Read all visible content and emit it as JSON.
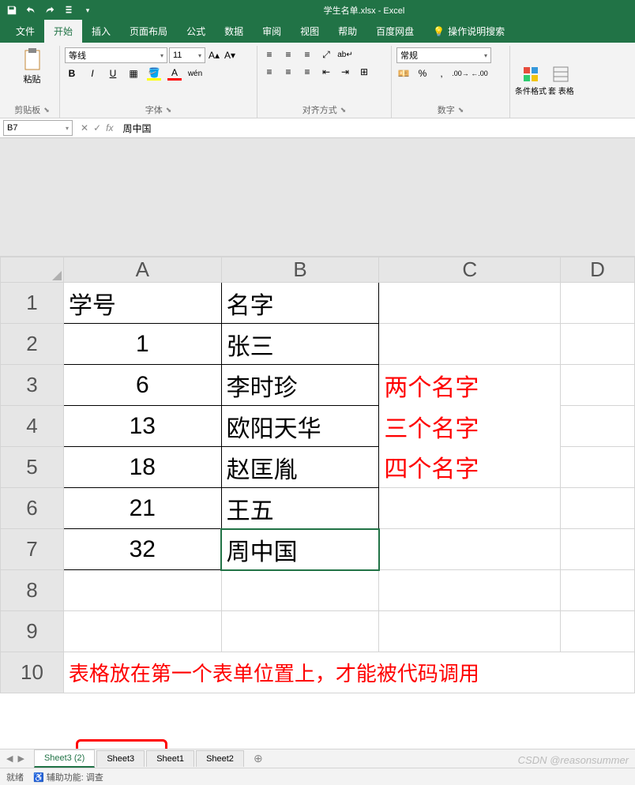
{
  "title": "学生名单.xlsx - Excel",
  "tabs": {
    "file": "文件",
    "home": "开始",
    "insert": "插入",
    "layout": "页面布局",
    "formulas": "公式",
    "data": "数据",
    "review": "审阅",
    "view": "视图",
    "help": "帮助",
    "baidu": "百度网盘",
    "tellme": "操作说明搜索"
  },
  "ribbon": {
    "clipboard": {
      "paste": "粘贴",
      "label": "剪贴板"
    },
    "font": {
      "name": "等线",
      "size": "11",
      "label": "字体"
    },
    "align": {
      "label": "对齐方式"
    },
    "number": {
      "format": "常规",
      "label": "数字"
    },
    "styles": {
      "condfmt": "条件格式",
      "tablefmt": "套\n表格"
    }
  },
  "namebox": "B7",
  "formula": "周中国",
  "columns": [
    "A",
    "B",
    "C",
    "D"
  ],
  "rows": [
    "1",
    "2",
    "3",
    "4",
    "5",
    "6",
    "7",
    "8",
    "9",
    "10"
  ],
  "cells": {
    "A1": "学号",
    "B1": "名字",
    "A2": "1",
    "B2": "张三",
    "A3": "6",
    "B3": "李时珍",
    "A4": "13",
    "B4": "欧阳天华",
    "A5": "18",
    "B5": "赵匡胤",
    "A6": "21",
    "B6": "王五",
    "A7": "32",
    "B7": "周中国"
  },
  "annotations": {
    "two": "两个名字",
    "three": "三个名字",
    "four": "四个名字",
    "note": "表格放在第一个表单位置上，才能被代码调用"
  },
  "sheets": {
    "s1": "Sheet3 (2)",
    "s2": "Sheet3",
    "s3": "Sheet1",
    "s4": "Sheet2"
  },
  "status": {
    "ready": "就绪",
    "access": "辅助功能: 调查"
  },
  "watermark": "CSDN @reasonsummer"
}
